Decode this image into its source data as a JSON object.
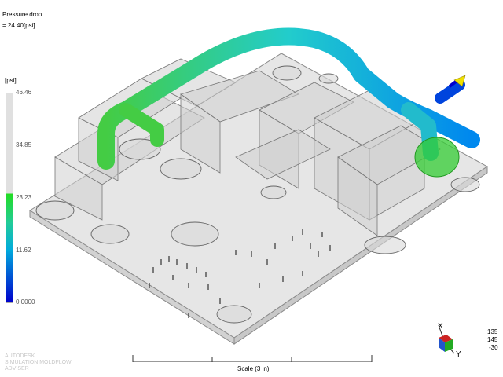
{
  "result": {
    "title": "Pressure drop",
    "value": "= 24.40[psi]"
  },
  "legend": {
    "unit": "[psi]",
    "ticks": [
      "46.46",
      "34.85",
      "23.23",
      "11.62",
      "0.0000"
    ]
  },
  "scale": {
    "label": "Scale (3 in)"
  },
  "brand": {
    "line1": "AUTODESK",
    "line2": "SIMULATION MOLDFLOW",
    "line3": "ADVISER"
  },
  "rotation": {
    "x": "135",
    "y": "145",
    "z": "-30"
  },
  "axes": {
    "x": "X",
    "y": "Y"
  },
  "colors": {
    "high": "#e0e0e0",
    "mid": "#22dd22",
    "low": "#0000cc",
    "injection_marker": "#f0e000"
  }
}
